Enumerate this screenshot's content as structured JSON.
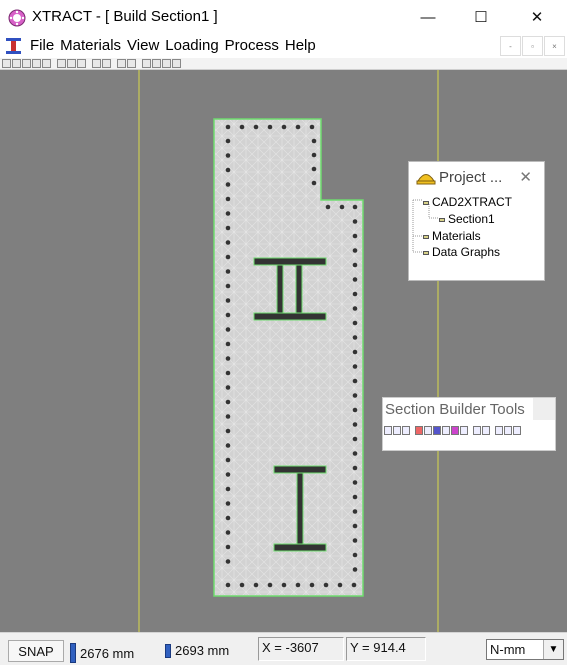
{
  "window": {
    "title": "XTRACT - [ Build Section1 ]",
    "minimize": "—",
    "maximize": "☐",
    "close": "✕"
  },
  "menu": {
    "items": [
      "File",
      "Materials",
      "View",
      "Loading",
      "Process",
      "Help"
    ]
  },
  "project_panel": {
    "title": "Project ...",
    "close": "✕",
    "tree": [
      {
        "label": "CAD2XTRACT",
        "level": 0
      },
      {
        "label": "Section1",
        "level": 1
      },
      {
        "label": "Materials",
        "level": 0
      },
      {
        "label": "Data Graphs",
        "level": 0
      }
    ]
  },
  "section_builder": {
    "title": "Section Builder Tools"
  },
  "status": {
    "snap": "SNAP",
    "width": "2676 mm",
    "height": "2693 mm",
    "x": "X = -3607",
    "y": "Y = 914.4",
    "units": "N-mm"
  },
  "colors": {
    "workspace": "#7f7f7f",
    "section_fill": "#d4d4d4",
    "outline": "#6fdc6f",
    "steel": "#2f2f2f",
    "guide": "#d8d84a"
  }
}
